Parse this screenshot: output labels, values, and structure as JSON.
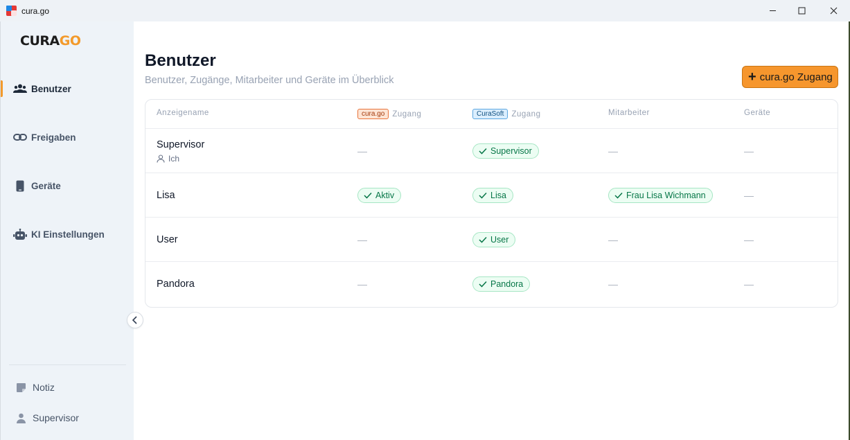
{
  "window": {
    "title": "cura.go"
  },
  "logo": {
    "part1": "CURA",
    "part2": "GO"
  },
  "sidebar": {
    "items": [
      {
        "label": "Benutzer",
        "icon": "users-icon",
        "active": true
      },
      {
        "label": "Freigaben",
        "icon": "link-icon",
        "active": false
      },
      {
        "label": "Geräte",
        "icon": "phone-icon",
        "active": false
      },
      {
        "label": "KI Einstellungen",
        "icon": "robot-icon",
        "active": false
      }
    ],
    "bottom": [
      {
        "label": "Notiz",
        "icon": "note-icon"
      },
      {
        "label": "Supervisor",
        "icon": "user-icon"
      }
    ]
  },
  "page": {
    "title": "Benutzer",
    "subtitle": "Benutzer, Zugänge, Mitarbeiter und Geräte im Überblick",
    "add_button": "cura.go Zugang"
  },
  "table": {
    "headers": {
      "name": "Anzeigename",
      "curago_tag": "cura.go",
      "curago_label": "Zugang",
      "curasoft_tag": "CuraSoft",
      "curasoft_label": "Zugang",
      "employee": "Mitarbeiter",
      "devices": "Geräte"
    },
    "rows": [
      {
        "name": "Supervisor",
        "sub": "Ich",
        "curago": "—",
        "curasoft": "Supervisor",
        "employee": "—",
        "devices": "—"
      },
      {
        "name": "Lisa",
        "curago": "Aktiv",
        "curasoft": "Lisa",
        "employee": "Frau Lisa Wichmann",
        "devices": "—"
      },
      {
        "name": "User",
        "curago": "—",
        "curasoft": "User",
        "employee": "—",
        "devices": "—"
      },
      {
        "name": "Pandora",
        "curago": "—",
        "curasoft": "Pandora",
        "employee": "—",
        "devices": "—"
      }
    ]
  },
  "colors": {
    "accent": "#f6962d",
    "success_bg": "#ecfdf3",
    "success_text": "#067647",
    "sidebar_bg": "#eef3f8"
  }
}
